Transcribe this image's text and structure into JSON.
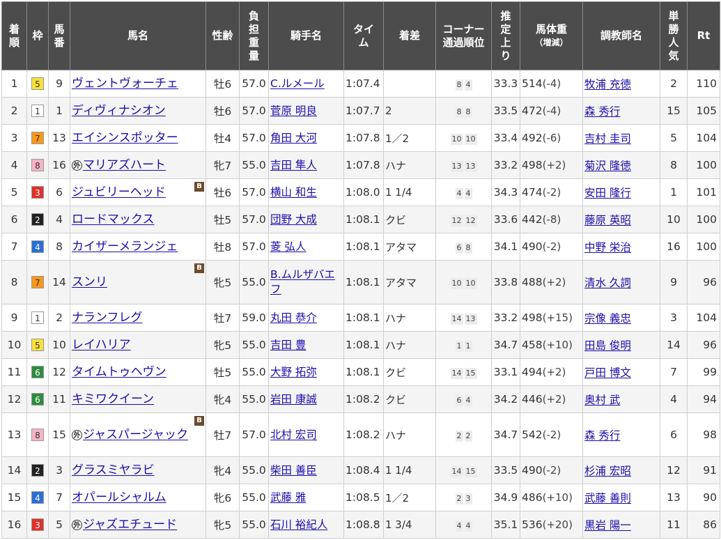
{
  "headers": {
    "rank": "着順",
    "waku": "枠",
    "umaban": "馬番",
    "horse": "馬名",
    "sexage": "性齢",
    "weight_carried": "負担重量",
    "jockey": "騎手名",
    "time": "タイム",
    "margin": "着差",
    "corner_line1": "コーナー",
    "corner_line2": "通過順位",
    "last3f": "推定上り",
    "body_weight_line1": "馬体重",
    "body_weight_line2": "（増減）",
    "trainer": "調教師名",
    "popularity": "単勝人気",
    "rating": "Rt"
  },
  "waku_colors": {
    "1": {
      "bg": "#ffffff",
      "fg": "#333333"
    },
    "2": {
      "bg": "#222222",
      "fg": "#ffffff"
    },
    "3": {
      "bg": "#e0302b",
      "fg": "#ffffff"
    },
    "4": {
      "bg": "#2a6fd6",
      "fg": "#ffffff"
    },
    "5": {
      "bg": "#f7e13a",
      "fg": "#333333"
    },
    "6": {
      "bg": "#2e8b3e",
      "fg": "#ffffff"
    },
    "7": {
      "bg": "#f7981d",
      "fg": "#333333"
    },
    "8": {
      "bg": "#f7b3c6",
      "fg": "#333333"
    }
  },
  "icons": {
    "foreign": "外",
    "blinker": "B"
  },
  "rows": [
    {
      "rank": "1",
      "waku": "5",
      "umaban": "9",
      "ext": false,
      "blinker": false,
      "horse": "ヴェントヴォーチェ",
      "sexage": "牡6",
      "wc": "57.0",
      "jockey": "C.ルメール",
      "time": "1:07.4",
      "margin": "",
      "c1": "8",
      "c2": "4",
      "last3f": "33.3",
      "bw": "514",
      "bwd": "(-4)",
      "trainer": "牧浦 充徳",
      "pop": "2",
      "rt": "110"
    },
    {
      "rank": "2",
      "waku": "1",
      "umaban": "1",
      "ext": false,
      "blinker": false,
      "horse": "ディヴィナシオン",
      "sexage": "牡6",
      "wc": "57.0",
      "jockey": "菅原 明良",
      "time": "1:07.7",
      "margin": "2",
      "c1": "8",
      "c2": "8",
      "last3f": "33.5",
      "bw": "472",
      "bwd": "(-4)",
      "trainer": "森 秀行",
      "pop": "15",
      "rt": "105"
    },
    {
      "rank": "3",
      "waku": "7",
      "umaban": "13",
      "ext": false,
      "blinker": false,
      "horse": "エイシンスポッター",
      "sexage": "牡4",
      "wc": "57.0",
      "jockey": "角田 大河",
      "time": "1:07.8",
      "margin": "1／2",
      "c1": "10",
      "c2": "10",
      "last3f": "33.4",
      "bw": "492",
      "bwd": "(-6)",
      "trainer": "吉村 圭司",
      "pop": "5",
      "rt": "104"
    },
    {
      "rank": "4",
      "waku": "8",
      "umaban": "16",
      "ext": true,
      "blinker": false,
      "horse": "マリアズハート",
      "sexage": "牝7",
      "wc": "55.0",
      "jockey": "吉田 隼人",
      "time": "1:07.8",
      "margin": "ハナ",
      "c1": "13",
      "c2": "13",
      "last3f": "33.2",
      "bw": "498",
      "bwd": "(+2)",
      "trainer": "菊沢 隆徳",
      "pop": "8",
      "rt": "100"
    },
    {
      "rank": "5",
      "waku": "3",
      "umaban": "6",
      "ext": false,
      "blinker": true,
      "horse": "ジュビリーヘッド",
      "sexage": "牡6",
      "wc": "57.0",
      "jockey": "横山 和生",
      "time": "1:08.0",
      "margin": "1 1/4",
      "c1": "4",
      "c2": "4",
      "last3f": "34.3",
      "bw": "474",
      "bwd": "(-2)",
      "trainer": "安田 隆行",
      "pop": "1",
      "rt": "101"
    },
    {
      "rank": "6",
      "waku": "2",
      "umaban": "4",
      "ext": false,
      "blinker": false,
      "horse": "ロードマックス",
      "sexage": "牡5",
      "wc": "57.0",
      "jockey": "団野 大成",
      "time": "1:08.1",
      "margin": "クビ",
      "c1": "12",
      "c2": "12",
      "last3f": "33.6",
      "bw": "442",
      "bwd": "(-8)",
      "trainer": "藤原 英昭",
      "pop": "10",
      "rt": "100"
    },
    {
      "rank": "7",
      "waku": "4",
      "umaban": "8",
      "ext": false,
      "blinker": false,
      "horse": "カイザーメランジェ",
      "sexage": "牡8",
      "wc": "57.0",
      "jockey": "菱 弘人",
      "time": "1:08.1",
      "margin": "アタマ",
      "c1": "6",
      "c2": "8",
      "last3f": "34.1",
      "bw": "490",
      "bwd": "(-2)",
      "trainer": "中野 栄治",
      "pop": "16",
      "rt": "100"
    },
    {
      "rank": "8",
      "waku": "7",
      "umaban": "14",
      "ext": false,
      "blinker": true,
      "horse": "スンリ",
      "sexage": "牝5",
      "wc": "55.0",
      "jockey": "B.ムルザバエフ",
      "time": "1:08.1",
      "margin": "アタマ",
      "c1": "10",
      "c2": "10",
      "last3f": "33.8",
      "bw": "488",
      "bwd": "(+2)",
      "trainer": "清水 久詞",
      "pop": "9",
      "rt": "96"
    },
    {
      "rank": "9",
      "waku": "1",
      "umaban": "2",
      "ext": false,
      "blinker": false,
      "horse": "ナランフレグ",
      "sexage": "牡7",
      "wc": "59.0",
      "jockey": "丸田 恭介",
      "time": "1:08.1",
      "margin": "ハナ",
      "c1": "14",
      "c2": "13",
      "last3f": "33.2",
      "bw": "498",
      "bwd": "(+15)",
      "trainer": "宗像 義忠",
      "pop": "3",
      "rt": "104"
    },
    {
      "rank": "10",
      "waku": "5",
      "umaban": "10",
      "ext": false,
      "blinker": false,
      "horse": "レイハリア",
      "sexage": "牝5",
      "wc": "55.0",
      "jockey": "吉田 豊",
      "time": "1:08.1",
      "margin": "ハナ",
      "c1": "1",
      "c2": "1",
      "last3f": "34.7",
      "bw": "458",
      "bwd": "(+10)",
      "trainer": "田島 俊明",
      "pop": "14",
      "rt": "96"
    },
    {
      "rank": "11",
      "waku": "6",
      "umaban": "12",
      "ext": false,
      "blinker": false,
      "horse": "タイムトゥヘヴン",
      "sexage": "牡5",
      "wc": "55.0",
      "jockey": "大野 拓弥",
      "time": "1:08.1",
      "margin": "クビ",
      "c1": "14",
      "c2": "15",
      "last3f": "33.1",
      "bw": "494",
      "bwd": "(+2)",
      "trainer": "戸田 博文",
      "pop": "7",
      "rt": "99"
    },
    {
      "rank": "12",
      "waku": "6",
      "umaban": "11",
      "ext": false,
      "blinker": false,
      "horse": "キミワクイーン",
      "sexage": "牝4",
      "wc": "55.0",
      "jockey": "岩田 康誠",
      "time": "1:08.2",
      "margin": "クビ",
      "c1": "6",
      "c2": "4",
      "last3f": "34.2",
      "bw": "446",
      "bwd": "(+2)",
      "trainer": "奥村 武",
      "pop": "4",
      "rt": "94"
    },
    {
      "rank": "13",
      "waku": "8",
      "umaban": "15",
      "ext": true,
      "blinker": true,
      "horse": "ジャスパージャック",
      "sexage": "牡7",
      "wc": "57.0",
      "jockey": "北村 宏司",
      "time": "1:08.2",
      "margin": "ハナ",
      "c1": "2",
      "c2": "2",
      "last3f": "34.7",
      "bw": "542",
      "bwd": "(-2)",
      "trainer": "森 秀行",
      "pop": "6",
      "rt": "98"
    },
    {
      "rank": "14",
      "waku": "2",
      "umaban": "3",
      "ext": false,
      "blinker": false,
      "horse": "グラスミヤラビ",
      "sexage": "牝4",
      "wc": "55.0",
      "jockey": "柴田 善臣",
      "time": "1:08.4",
      "margin": "1 1/4",
      "c1": "14",
      "c2": "15",
      "last3f": "33.5",
      "bw": "490",
      "bwd": "(-2)",
      "trainer": "杉浦 宏昭",
      "pop": "12",
      "rt": "91"
    },
    {
      "rank": "15",
      "waku": "4",
      "umaban": "7",
      "ext": false,
      "blinker": false,
      "horse": "オパールシャルム",
      "sexage": "牝6",
      "wc": "55.0",
      "jockey": "武藤 雅",
      "time": "1:08.5",
      "margin": "1／2",
      "c1": "2",
      "c2": "3",
      "last3f": "34.9",
      "bw": "486",
      "bwd": "(+10)",
      "trainer": "武藤 善則",
      "pop": "13",
      "rt": "90"
    },
    {
      "rank": "16",
      "waku": "3",
      "umaban": "5",
      "ext": true,
      "blinker": false,
      "horse": "ジャズエチュード",
      "sexage": "牝5",
      "wc": "55.0",
      "jockey": "石川 裕紀人",
      "time": "1:08.8",
      "margin": "1 3/4",
      "c1": "4",
      "c2": "4",
      "last3f": "35.1",
      "bw": "536",
      "bwd": "(+20)",
      "trainer": "黒岩 陽一",
      "pop": "11",
      "rt": "86"
    }
  ]
}
